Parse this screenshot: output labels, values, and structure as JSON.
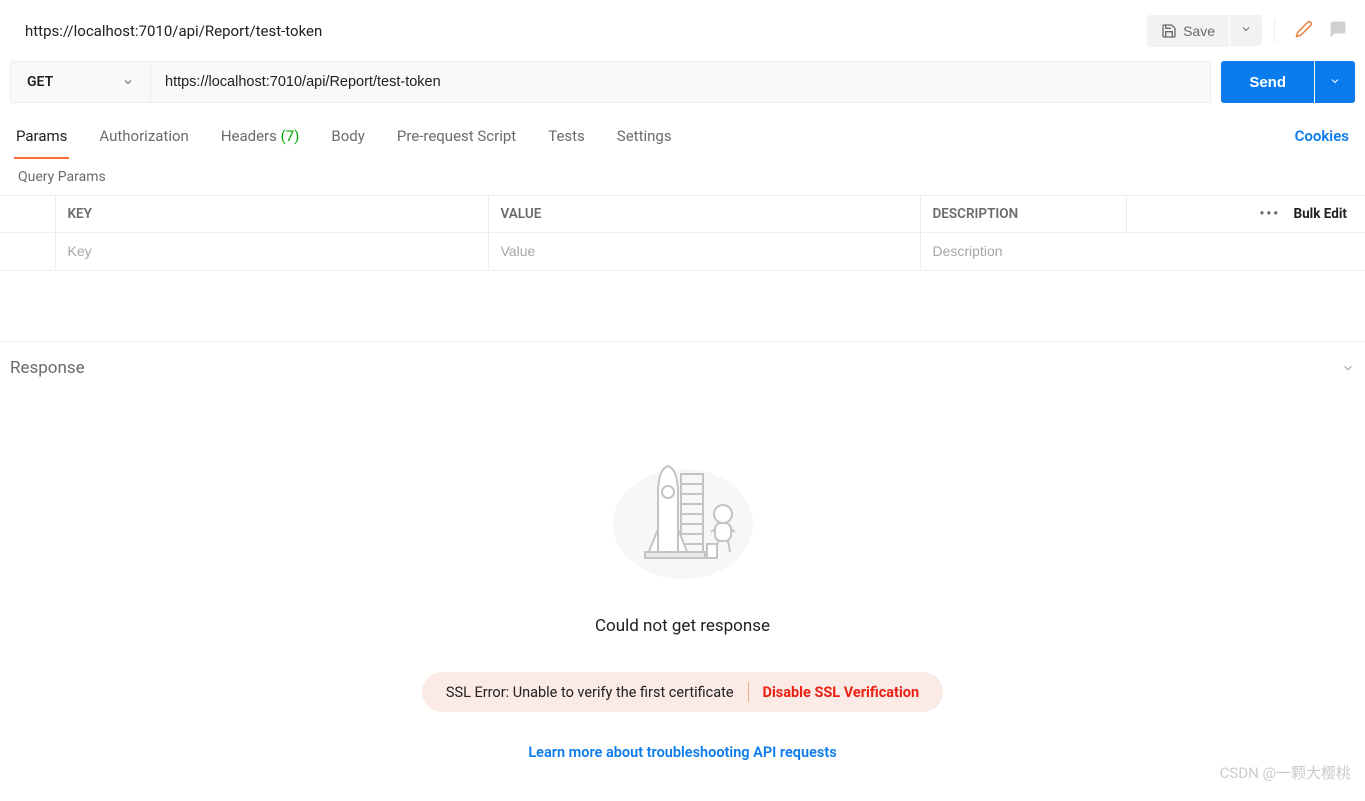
{
  "header": {
    "title": "https://localhost:7010/api/Report/test-token",
    "save_label": "Save"
  },
  "request": {
    "method": "GET",
    "url": "https://localhost:7010/api/Report/test-token",
    "send_label": "Send"
  },
  "tabs": {
    "items": [
      {
        "label": "Params",
        "active": true
      },
      {
        "label": "Authorization"
      },
      {
        "label": "Headers",
        "count": "(7)"
      },
      {
        "label": "Body"
      },
      {
        "label": "Pre-request Script"
      },
      {
        "label": "Tests"
      },
      {
        "label": "Settings"
      }
    ],
    "cookies_label": "Cookies"
  },
  "query_params": {
    "section_label": "Query Params",
    "headers": {
      "key": "KEY",
      "value": "VALUE",
      "description": "DESCRIPTION",
      "bulk_edit": "Bulk Edit"
    },
    "placeholders": {
      "key": "Key",
      "value": "Value",
      "description": "Description"
    }
  },
  "response": {
    "label": "Response",
    "no_response": "Could not get response",
    "error_text": "SSL Error: Unable to verify the first certificate",
    "error_action": "Disable SSL Verification",
    "learn_more": "Learn more about troubleshooting API requests"
  },
  "watermark": "CSDN @一颗大樱桃"
}
